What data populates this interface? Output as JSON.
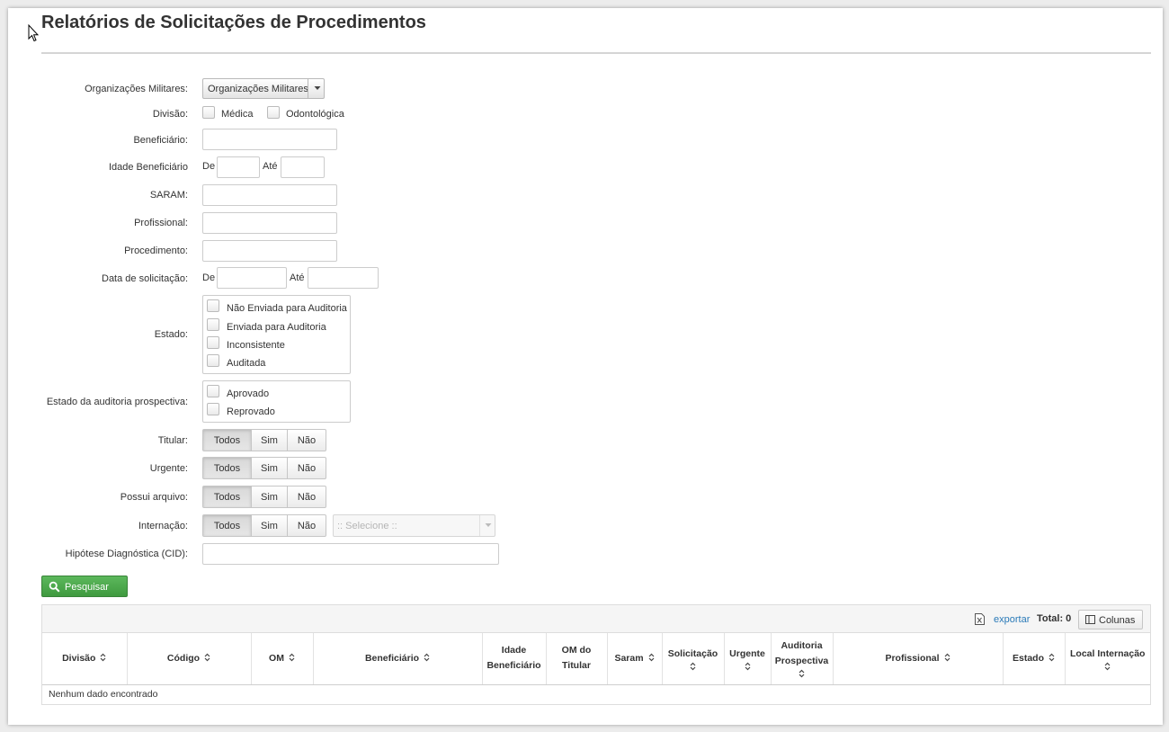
{
  "page": {
    "title": "Relatórios de Solicitações de Procedimentos"
  },
  "filters": {
    "organizacoes": {
      "label": "Organizações Militares:",
      "selected": "Organizações Militares"
    },
    "divisao": {
      "label": "Divisão:",
      "options": [
        "Médica",
        "Odontológica"
      ]
    },
    "beneficiario": {
      "label": "Beneficiário:",
      "value": ""
    },
    "idade": {
      "label": "Idade Beneficiário",
      "from_label": "De",
      "to_label": "Até",
      "from_value": "",
      "to_value": ""
    },
    "saram": {
      "label": "SARAM:",
      "value": ""
    },
    "profissional": {
      "label": "Profissional:",
      "value": ""
    },
    "procedimento": {
      "label": "Procedimento:",
      "value": ""
    },
    "data_solicitacao": {
      "label": "Data de solicitação:",
      "from_label": "De",
      "to_label": "Até",
      "from_value": "",
      "to_value": ""
    },
    "estado": {
      "label": "Estado:",
      "options": [
        "Não Enviada para Auditoria",
        "Enviada para Auditoria",
        "Inconsistente",
        "Auditada"
      ]
    },
    "estado_auditoria": {
      "label": "Estado da auditoria prospectiva:",
      "options": [
        "Aprovado",
        "Reprovado"
      ]
    },
    "titular": {
      "label": "Titular:",
      "options": [
        "Todos",
        "Sim",
        "Não"
      ],
      "selected": "Todos"
    },
    "urgente": {
      "label": "Urgente:",
      "options": [
        "Todos",
        "Sim",
        "Não"
      ],
      "selected": "Todos"
    },
    "possui_arquivo": {
      "label": "Possui arquivo:",
      "options": [
        "Todos",
        "Sim",
        "Não"
      ],
      "selected": "Todos"
    },
    "internacao": {
      "label": "Internação:",
      "options": [
        "Todos",
        "Sim",
        "Não"
      ],
      "selected": "Todos",
      "select_placeholder": ":: Selecione ::"
    },
    "cid": {
      "label": "Hipótese Diagnóstica (CID):",
      "value": ""
    }
  },
  "search_button": {
    "label": "Pesquisar",
    "icon": "search-icon"
  },
  "results": {
    "export_label": "exportar",
    "total_label": "Total: 0",
    "columns_button": "Colunas",
    "columns": [
      {
        "label": "Divisão",
        "sortable": true
      },
      {
        "label": "Código",
        "sortable": true
      },
      {
        "label": "OM",
        "sortable": true
      },
      {
        "label": "Beneficiário",
        "sortable": true
      },
      {
        "label": "Idade Beneficiário",
        "sortable": false
      },
      {
        "label": "OM do Titular",
        "sortable": false
      },
      {
        "label": "Saram",
        "sortable": true
      },
      {
        "label": "Solicitação",
        "sortable": true
      },
      {
        "label": "Urgente",
        "sortable": true
      },
      {
        "label": "Auditoria Prospectiva",
        "sortable": true
      },
      {
        "label": "Profissional",
        "sortable": true
      },
      {
        "label": "Estado",
        "sortable": true
      },
      {
        "label": "Local Internação",
        "sortable": true
      }
    ],
    "empty_message": "Nenhum dado encontrado"
  },
  "colors": {
    "accent_green": "#4cae4c",
    "link_blue": "#2a7ab8",
    "border": "#cccccc"
  }
}
